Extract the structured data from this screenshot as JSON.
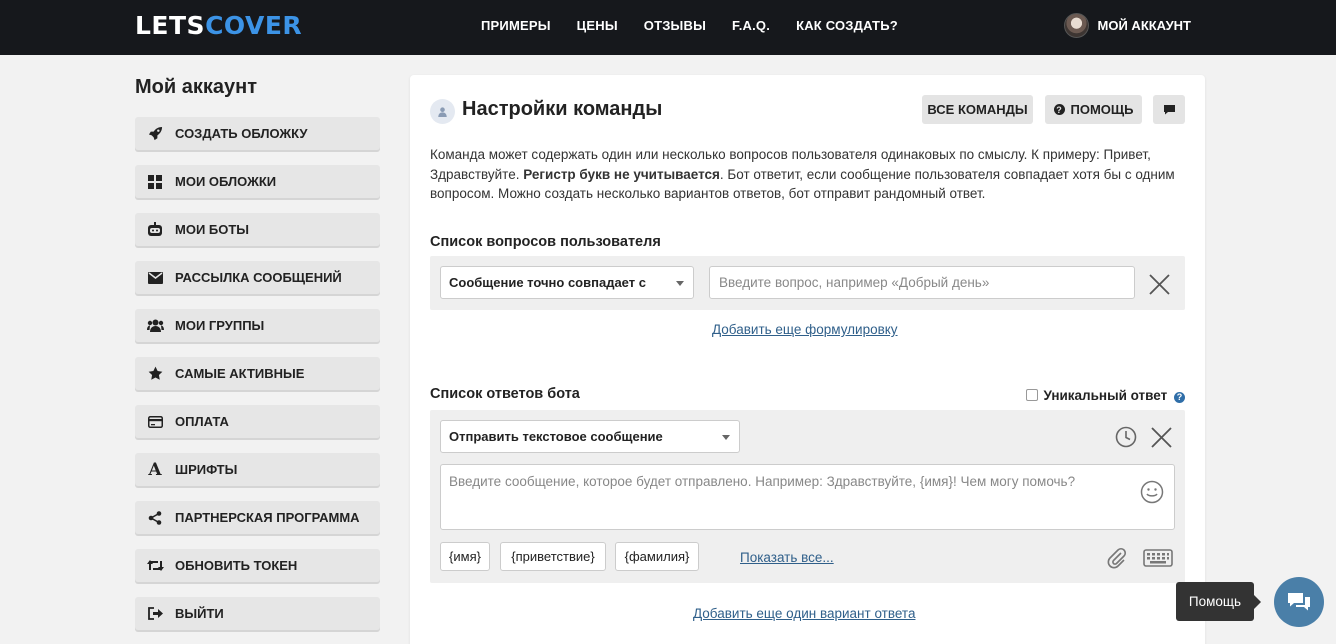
{
  "header": {
    "logo_part1": "LETS",
    "logo_part2": "COVER",
    "nav": [
      "ПРИМЕРЫ",
      "ЦЕНЫ",
      "ОТЗЫВЫ",
      "F.A.Q.",
      "КАК СОЗДАТЬ?"
    ],
    "account_label": "МОЙ АККАУНТ"
  },
  "sidebar": {
    "title": "Мой аккаунт",
    "items": [
      {
        "label": "СОЗДАТЬ ОБЛОЖКУ",
        "icon": "rocket-icon"
      },
      {
        "label": "МОИ ОБЛОЖКИ",
        "icon": "grid-icon"
      },
      {
        "label": "МОИ БОТЫ",
        "icon": "robot-icon"
      },
      {
        "label": "РАССЫЛКА СООБЩЕНИЙ",
        "icon": "envelope-icon"
      },
      {
        "label": "МОИ ГРУППЫ",
        "icon": "users-icon"
      },
      {
        "label": "САМЫЕ АКТИВНЫЕ",
        "icon": "star-icon"
      },
      {
        "label": "ОПЛАТА",
        "icon": "credit-card-icon"
      },
      {
        "label": "ШРИФТЫ",
        "icon": "font-icon"
      },
      {
        "label": "ПАРТНЕРСКАЯ ПРОГРАММА",
        "icon": "share-icon"
      },
      {
        "label": "ОБНОВИТЬ ТОКЕН",
        "icon": "retweet-icon"
      },
      {
        "label": "ВЫЙТИ",
        "icon": "sign-out-icon"
      }
    ]
  },
  "main": {
    "title": "Настройки команды",
    "buttons": {
      "all_commands": "ВСЕ КОМАНДЫ",
      "help": "ПОМОЩЬ"
    },
    "description_1": "Команда может содержать один или несколько вопросов пользователя одинаковых по смыслу. К примеру: Привет, Здравствуйте. ",
    "description_bold": "Регистр букв не учитывается",
    "description_2": ". Бот ответит, если сообщение пользователя совпадает хотя бы с одним вопросом. Можно создать несколько вариантов ответов, бот отправит рандомный ответ.",
    "questions": {
      "title": "Список вопросов пользователя",
      "match_select": "Сообщение точно совпадает с",
      "question_placeholder": "Введите вопрос, например «Добрый день»",
      "add_link": "Добавить еще формулировку"
    },
    "answers": {
      "title": "Список ответов бота",
      "unique_label": "Уникальный ответ",
      "type_select": "Отправить текстовое сообщение",
      "message_placeholder": "Введите сообщение, которое будет отправлено. Например: Здравствуйте, {имя}! Чем могу помочь?",
      "chips": [
        "{имя}",
        "{приветствие}",
        "{фамилия}"
      ],
      "show_all": "Показать все...",
      "add_link": "Добавить еще один вариант ответа"
    }
  },
  "help_widget": {
    "tooltip": "Помощь"
  },
  "colors": {
    "header_bg": "#16181c",
    "brand_blue": "#3c93e6",
    "link": "#2f5f8a",
    "fab": "#4a7fa8"
  }
}
